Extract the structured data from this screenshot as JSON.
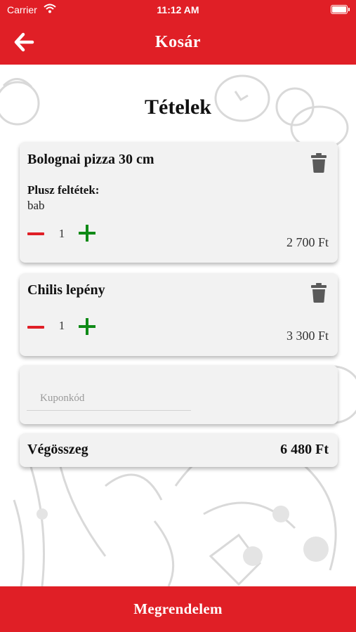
{
  "status_bar": {
    "carrier": "Carrier",
    "time": "11:12 AM"
  },
  "header": {
    "title": "Kosár",
    "back_icon": "arrow-left-icon"
  },
  "section_title": "Tételek",
  "items": [
    {
      "name": "Bolognai pizza 30 cm",
      "extras_label": "Plusz feltétek:",
      "extras_value": "bab",
      "quantity": "1",
      "price": "2 700 Ft"
    },
    {
      "name": "Chilis lepény",
      "quantity": "1",
      "price": "3 300 Ft"
    }
  ],
  "coupon": {
    "placeholder": "Kuponkód",
    "value": ""
  },
  "total": {
    "label": "Végösszeg",
    "value": "6 480 Ft"
  },
  "order_button": {
    "label": "Megrendelem"
  },
  "colors": {
    "brand_red": "#e01f26",
    "plus_green": "#0f8a17",
    "card_bg": "#f2f2f2"
  }
}
